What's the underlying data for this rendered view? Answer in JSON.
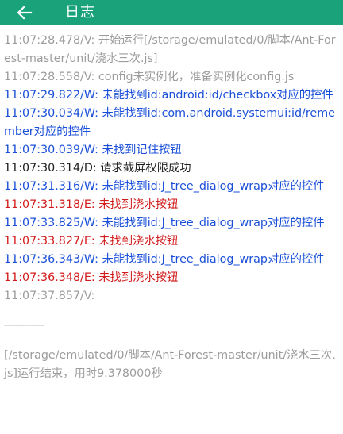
{
  "app_bar": {
    "title": "日志",
    "back_icon": "arrow-left-icon",
    "background": "#1aa37a"
  },
  "level_colors": {
    "V": "#9c9c9c",
    "W": "#1a4fd8",
    "D": "#1e1e1e",
    "E": "#d21c1c"
  },
  "log": [
    {
      "level": "V",
      "text": "11:07:28.478/V: 开始运行[/storage/emulated/0/脚本/Ant-Forest-master/unit/浇水三次.js]"
    },
    {
      "level": "V",
      "text": "11:07:28.558/V: config未实例化，准备实例化config.js"
    },
    {
      "level": "W",
      "text": "11:07:29.822/W: 未能找到id:android:id/checkbox对应的控件"
    },
    {
      "level": "W",
      "text": "11:07:30.034/W: 未能找到id:com.android.systemui:id/remember对应的控件"
    },
    {
      "level": "W",
      "text": "11:07:30.039/W: 未找到记住按钮"
    },
    {
      "level": "D",
      "text": "11:07:30.314/D: 请求截屏权限成功"
    },
    {
      "level": "W",
      "text": "11:07:31.316/W: 未能找到id:J_tree_dialog_wrap对应的控件"
    },
    {
      "level": "E",
      "text": "11:07:31.318/E: 未找到浇水按钮"
    },
    {
      "level": "W",
      "text": "11:07:33.825/W: 未能找到id:J_tree_dialog_wrap对应的控件"
    },
    {
      "level": "E",
      "text": "11:07:33.827/E: 未找到浇水按钮"
    },
    {
      "level": "W",
      "text": "11:07:36.343/W: 未能找到id:J_tree_dialog_wrap对应的控件"
    },
    {
      "level": "E",
      "text": "11:07:36.348/E: 未找到浇水按钮"
    },
    {
      "level": "V",
      "text": "11:07:37.857/V:"
    },
    {
      "level": "V",
      "separator": true,
      "text": "------------"
    },
    {
      "level": "V",
      "text": "[/storage/emulated/0/脚本/Ant-Forest-master/unit/浇水三次.js]运行结束，用时9.378000秒"
    }
  ]
}
